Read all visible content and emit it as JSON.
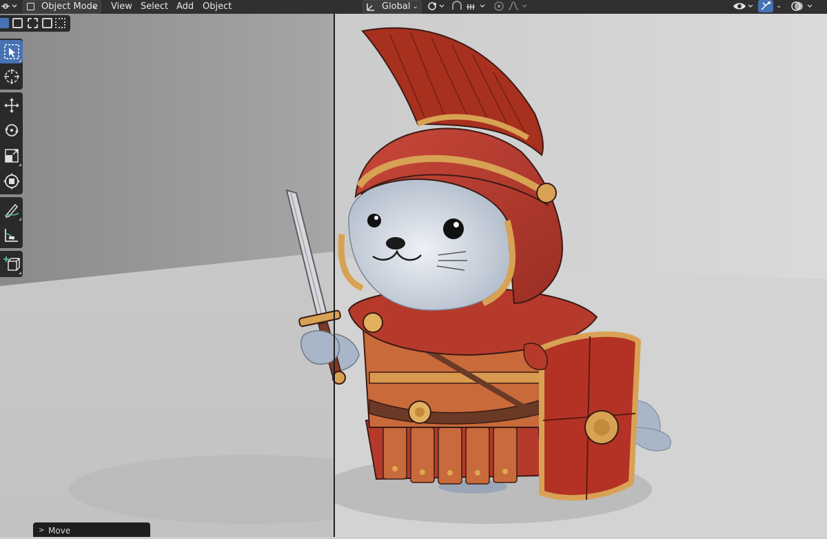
{
  "header": {
    "editor_type_icon": "viewport-editor-icon",
    "mode": "Object Mode",
    "menus": [
      "View",
      "Select",
      "Add",
      "Object"
    ],
    "transform_orientation": "Global",
    "pivot_icon": "pivot-point-icon",
    "snap_icon": "snap-magnet-icon",
    "snap_target_icon": "snap-increment-icon",
    "proportional_icon": "proportional-edit-icon",
    "falloff_icon": "falloff-curve-icon",
    "visibility_icon": "eye-visibility-icon",
    "gizmo_icon": "gizmo-icon",
    "overlay_icon": "overlay-icon"
  },
  "toolbar": {
    "tools": [
      {
        "name": "select-box",
        "icon": "select-box-icon",
        "active": true
      },
      {
        "name": "cursor",
        "icon": "cursor-icon",
        "active": false
      },
      {
        "name": "move",
        "icon": "move-icon",
        "active": false
      },
      {
        "name": "rotate",
        "icon": "rotate-icon",
        "active": false
      },
      {
        "name": "scale",
        "icon": "scale-icon",
        "active": false
      },
      {
        "name": "transform",
        "icon": "transform-icon",
        "active": false
      },
      {
        "name": "annotate",
        "icon": "annotate-icon",
        "active": false
      },
      {
        "name": "measure",
        "icon": "measure-icon",
        "active": false
      },
      {
        "name": "add-cube",
        "icon": "add-cube-icon",
        "active": false
      }
    ]
  },
  "operator_panel": {
    "label": "Move"
  },
  "colors": {
    "header_bg": "#303030",
    "active_tool": "#4772b3",
    "helmet_red": "#b63a2b",
    "gold_trim": "#d8a254",
    "seal_skin": "#aeb9c8"
  }
}
